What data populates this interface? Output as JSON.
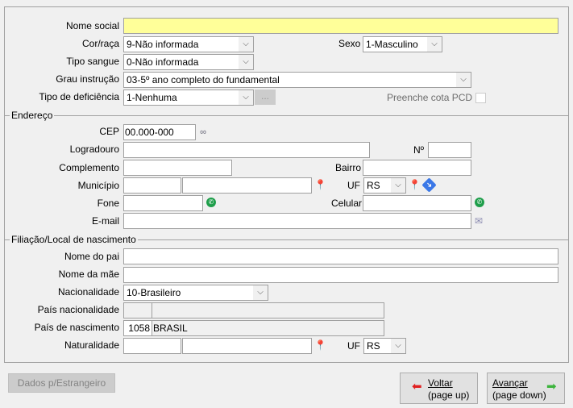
{
  "personal": {
    "nome_social": {
      "label": "Nome social",
      "value": ""
    },
    "cor_raca": {
      "label": "Cor/raça",
      "value": "9-Não informada"
    },
    "sexo": {
      "label": "Sexo",
      "value": "1-Masculino"
    },
    "tipo_sangue": {
      "label": "Tipo sangue",
      "value": "0-Não informada"
    },
    "grau_instrucao": {
      "label": "Grau instrução",
      "value": "03-5º ano completo do fundamental"
    },
    "tipo_deficiencia": {
      "label": "Tipo de deficiência",
      "value": "1-Nenhuma",
      "more_label": "..."
    },
    "cota_pcd": {
      "label": "Preenche cota PCD",
      "checked": false
    }
  },
  "endereco": {
    "title": "Endereço",
    "cep": {
      "label": "CEP",
      "value": "00.000-000"
    },
    "logradouro": {
      "label": "Logradouro",
      "value": ""
    },
    "numero": {
      "label": "Nº",
      "value": ""
    },
    "complemento": {
      "label": "Complemento",
      "value": ""
    },
    "bairro": {
      "label": "Bairro",
      "value": ""
    },
    "municipio": {
      "label": "Município",
      "code": "",
      "name": ""
    },
    "uf": {
      "label": "UF",
      "value": "RS"
    },
    "fone": {
      "label": "Fone",
      "value": ""
    },
    "celular": {
      "label": "Celular",
      "value": ""
    },
    "email": {
      "label": "E-mail",
      "value": ""
    }
  },
  "filiacao": {
    "title": "Filiação/Local de nascimento",
    "pai": {
      "label": "Nome do pai",
      "value": ""
    },
    "mae": {
      "label": "Nome da mãe",
      "value": ""
    },
    "nacionalidade": {
      "label": "Nacionalidade",
      "value": "10-Brasileiro"
    },
    "pais_nacionalidade": {
      "label": "País nacionalidade",
      "code": "",
      "name": ""
    },
    "pais_nascimento": {
      "label": "País de nascimento",
      "code": "1058",
      "name": "BRASIL"
    },
    "naturalidade": {
      "label": "Naturalidade",
      "code": "",
      "name": ""
    },
    "uf": {
      "label": "UF",
      "value": "RS"
    }
  },
  "buttons": {
    "estrangeiro": "Dados p/Estrangeiro",
    "voltar": "Voltar",
    "voltar_sub": "(page up)",
    "avancar": "Avançar",
    "avancar_sub": "(page down)"
  },
  "colors": {
    "required": "#ffff99",
    "whatsapp": "#1e9e4a",
    "arrow_back": "#e02020",
    "arrow_fwd": "#3cb43c"
  }
}
